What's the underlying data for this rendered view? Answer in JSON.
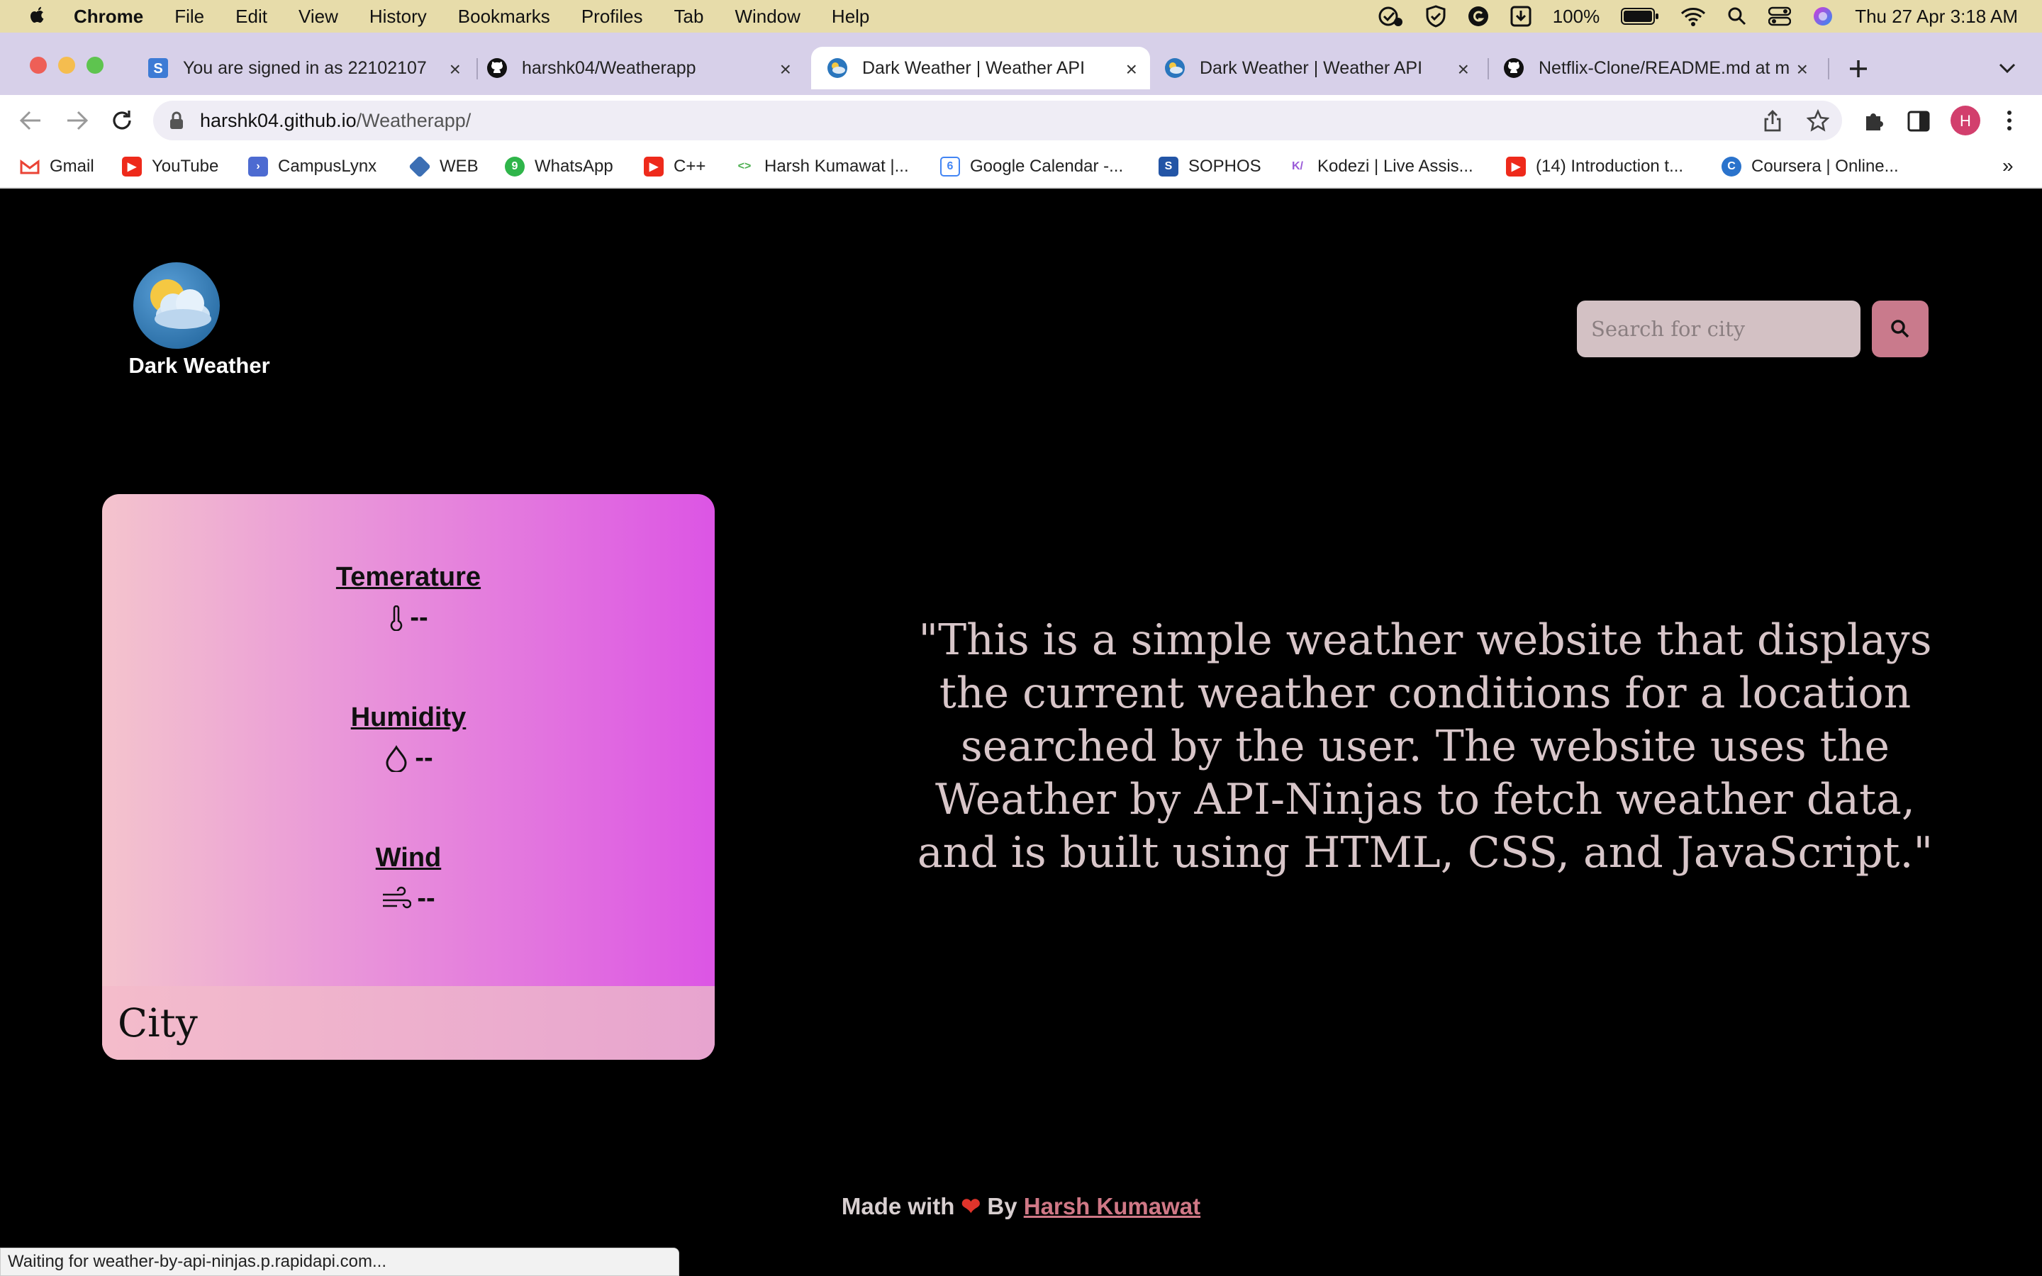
{
  "menubar": {
    "app": "Chrome",
    "items": [
      "File",
      "Edit",
      "View",
      "History",
      "Bookmarks",
      "Profiles",
      "Tab",
      "Window",
      "Help"
    ],
    "battery": "100%",
    "datetime": "Thu 27 Apr  3:18 AM"
  },
  "tabs": [
    {
      "title": "You are signed in as 22102107",
      "icon": "s-icon"
    },
    {
      "title": "harshk04/Weatherapp",
      "icon": "github-icon"
    },
    {
      "title": "Dark Weather | Weather API",
      "icon": "weather-icon"
    },
    {
      "title": "Dark Weather | Weather API",
      "icon": "weather-icon"
    },
    {
      "title": "Netflix-Clone/README.md at m",
      "icon": "github-icon"
    }
  ],
  "address": {
    "host": "harshk04.github.io",
    "path": "/Weatherapp/"
  },
  "bookmarks": [
    "Gmail",
    "YouTube",
    "CampusLynx",
    "WEB",
    "WhatsApp",
    "C++",
    "Harsh Kumawat |...",
    "Google Calendar -...",
    "SOPHOS",
    "Kodezi | Live Assis...",
    "(14) Introduction t...",
    "Coursera | Online..."
  ],
  "colors": {
    "accent": "#c97a8c",
    "card_start": "#f4c4cd",
    "card_end": "#dc55e4",
    "quote": "#d8c6c9"
  },
  "site": {
    "brand": "Dark Weather",
    "search_placeholder": "Search for city",
    "card": {
      "temperature_label": "Temerature",
      "temperature_value": "--",
      "humidity_label": "Humidity",
      "humidity_value": "--",
      "wind_label": "Wind",
      "wind_value": "--",
      "city": "City"
    },
    "quote": "\"This is a simple weather website that displays the current weather conditions for a location searched by the user. The website uses the Weather by API-Ninjas to fetch weather data, and is built using HTML, CSS, and JavaScript.\"",
    "footer": {
      "made_with": "Made with",
      "by": "By",
      "author": "Harsh Kumawat"
    }
  },
  "status": "Waiting for weather-by-api-ninjas.p.rapidapi.com..."
}
